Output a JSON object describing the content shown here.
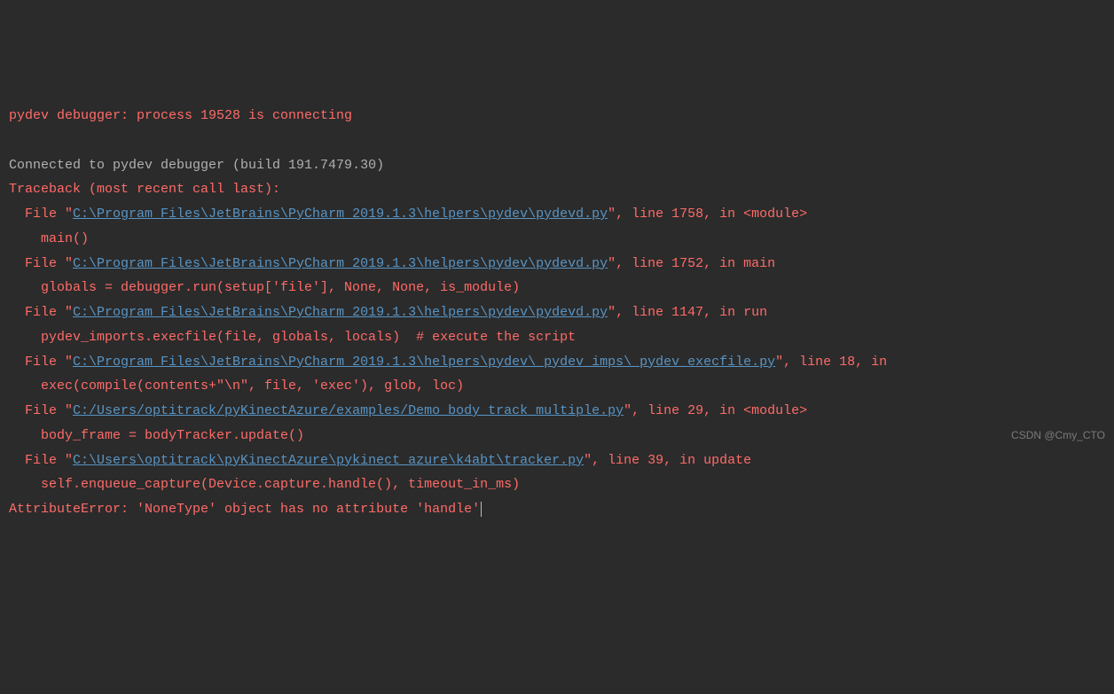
{
  "console": {
    "line1": "pydev debugger: process 19528 is connecting",
    "blank": " ",
    "connected": "Connected to pydev debugger (build 191.7479.30)",
    "traceback_header": "Traceback (most recent call last):",
    "frame1": {
      "prefix": "File \"",
      "path": "C:\\Program Files\\JetBrains\\PyCharm 2019.1.3\\helpers\\pydev\\pydevd.py",
      "suffix": "\", line 1758, in <module>",
      "code": "main()"
    },
    "frame2": {
      "prefix": "File \"",
      "path": "C:\\Program Files\\JetBrains\\PyCharm 2019.1.3\\helpers\\pydev\\pydevd.py",
      "suffix": "\", line 1752, in main",
      "code": "globals = debugger.run(setup['file'], None, None, is_module)"
    },
    "frame3": {
      "prefix": "File \"",
      "path": "C:\\Program Files\\JetBrains\\PyCharm 2019.1.3\\helpers\\pydev\\pydevd.py",
      "suffix": "\", line 1147, in run",
      "code": "pydev_imports.execfile(file, globals, locals)  # execute the script"
    },
    "frame4": {
      "prefix": "File \"",
      "path": "C:\\Program Files\\JetBrains\\PyCharm 2019.1.3\\helpers\\pydev\\_pydev_imps\\_pydev_execfile.py",
      "suffix": "\", line 18, in ",
      "code": "exec(compile(contents+\"\\n\", file, 'exec'), glob, loc)"
    },
    "frame5": {
      "prefix": "File \"",
      "path": "C:/Users/optitrack/pyKinectAzure/examples/Demo_body_track_multiple.py",
      "suffix": "\", line 29, in <module>",
      "code": "body_frame = bodyTracker.update()"
    },
    "frame6": {
      "prefix": "File \"",
      "path": "C:\\Users\\optitrack\\pyKinectAzure\\pykinect_azure\\k4abt\\tracker.py",
      "suffix": "\", line 39, in update",
      "code": "self.enqueue_capture(Device.capture.handle(), timeout_in_ms)"
    },
    "error": "AttributeError: 'NoneType' object has no attribute 'handle'"
  },
  "watermark": "CSDN @Cmy_CTO"
}
